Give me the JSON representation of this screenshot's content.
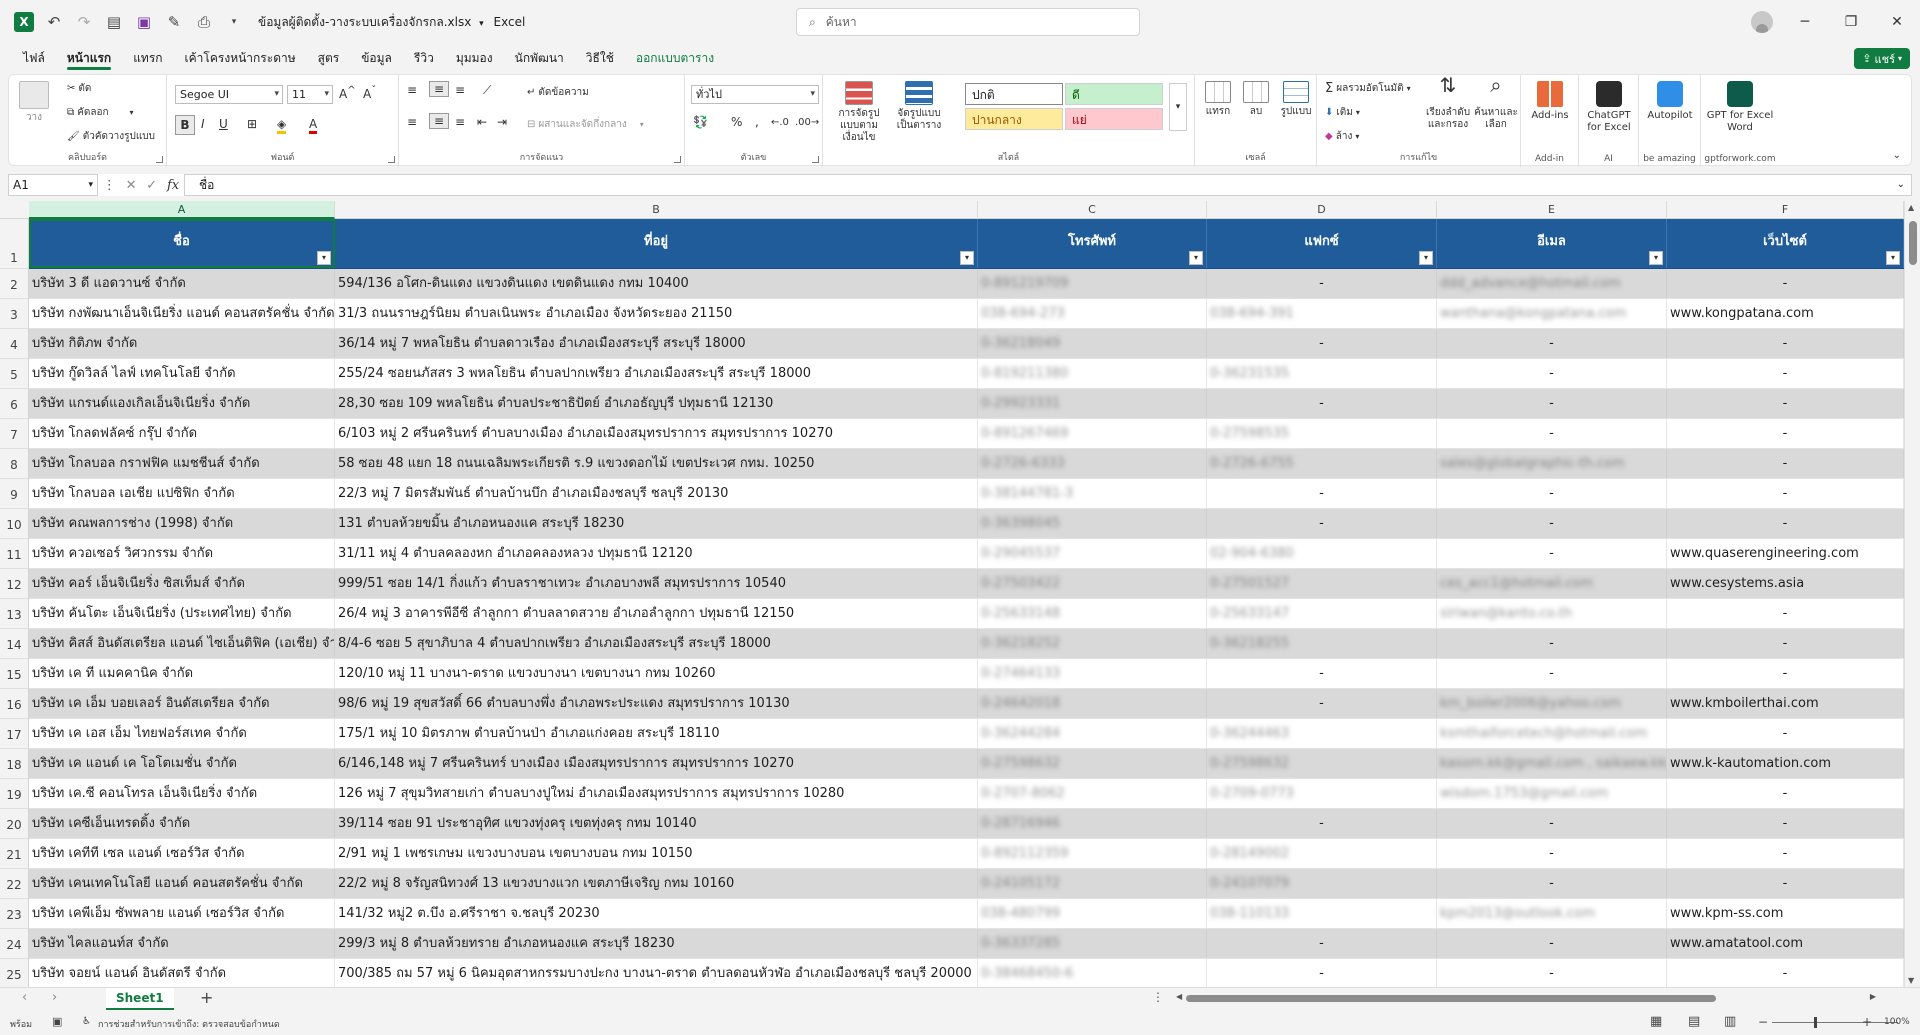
{
  "window": {
    "file_name": "ข้อมูลผู้ติดตั้ง-วางระบบเครื่องจักรกล.xlsx",
    "app_name": "Excel",
    "search_placeholder": "ค้นหา",
    "share_label": "แชร์"
  },
  "menu": [
    "ไฟล์",
    "หน้าแรก",
    "แทรก",
    "เค้าโครงหน้ากระดาษ",
    "สูตร",
    "ข้อมูล",
    "รีวิว",
    "มุมมอง",
    "นักพัฒนา",
    "วิธีใช้",
    "ออกแบบตาราง"
  ],
  "ribbon": {
    "clipboard": {
      "label": "คลิปบอร์ด",
      "paste": "วาง",
      "cut": "ตัด",
      "copy": "คัดลอก",
      "format_painter": "ตัวคัดวางรูปแบบ"
    },
    "font": {
      "label": "ฟอนต์",
      "name": "Segoe UI",
      "size": "11"
    },
    "alignment": {
      "label": "การจัดแนว",
      "wrap": "ตัดข้อความ",
      "merge": "ผสานและจัดกึ่งกลาง"
    },
    "number": {
      "label": "ตัวเลข",
      "format": "ทั่วไป"
    },
    "styles": {
      "label": "สไตล์",
      "cond": "การจัดรูปแบบตามเงื่อนไข",
      "table": "จัดรูปแบบเป็นตาราง",
      "normal": "ปกติ",
      "good": "ดี",
      "neutral": "ปานกลาง",
      "bad": "แย่"
    },
    "cells": {
      "label": "เซลล์",
      "insert": "แทรก",
      "delete": "ลบ",
      "format": "รูปแบบ"
    },
    "editing": {
      "label": "การแก้ไข",
      "autosum": "ผลรวมอัตโนมัติ",
      "fill": "เติม",
      "clear": "ล้าง",
      "sort": "เรียงลำดับและกรอง",
      "find": "ค้นหาและเลือก"
    },
    "addins": {
      "label": "Add-in",
      "btn": "Add-ins"
    },
    "ai": {
      "label": "AI",
      "btn": "ChatGPT for Excel"
    },
    "autopilot": {
      "label": "be amazing",
      "btn": "Autopilot"
    },
    "gptword": {
      "label": "gptforwork.com",
      "btn": "GPT for Excel Word"
    }
  },
  "formula": {
    "cell": "A1",
    "content": "ชื่อ"
  },
  "columns": [
    "A",
    "B",
    "C",
    "D",
    "E",
    "F"
  ],
  "headers": [
    "ชื่อ",
    "ที่อยู่",
    "โทรศัพท์",
    "แฟกซ์",
    "อีเมล",
    "เว็บไซต์"
  ],
  "rows": [
    {
      "n": "2",
      "name": "บริษัท 3 ดี แอดวานซ์ จำกัด",
      "addr": "594/136 อโศก-ดินแดง แขวงดินแดง เขตดินแดง กทม 10400",
      "tel": "0-891219709",
      "fax": "-",
      "email": "ddd_advance@hotmail.com",
      "web": "-"
    },
    {
      "n": "3",
      "name": "บริษัท กงพัฒนาเอ็นจิเนียริ่ง แอนด์ คอนสตรัคชั่น จำกัด",
      "addr": "31/3 ถนนราษฎร์นิยม ตำบลเนินพระ อำเภอเมือง จังหวัดระยอง 21150",
      "tel": "038-694-273",
      "fax": "038-694-391",
      "email": "wanthana@kongpatana.com",
      "web": "www.kongpatana.com"
    },
    {
      "n": "4",
      "name": "บริษัท กิติภพ จำกัด",
      "addr": "36/14 หมู่ 7 พหลโยธิน ตำบลดาวเรือง อำเภอเมืองสระบุรี สระบุรี 18000",
      "tel": "0-36218049",
      "fax": "-",
      "email": "-",
      "web": "-"
    },
    {
      "n": "5",
      "name": "บริษัท กู๊ดวิลล์ ไลฟ์ เทคโนโลยี จำกัด",
      "addr": "255/24 ซอยนภัสสร 3 พหลโยธิน ตำบลปากเพรียว อำเภอเมืองสระบุรี สระบุรี 18000",
      "tel": "0-819211380",
      "fax": "0-36231535",
      "email": "-",
      "web": "-"
    },
    {
      "n": "6",
      "name": "บริษัท แกรนด์แองเกิลเอ็นจิเนียริ่ง จำกัด",
      "addr": "28,30 ซอย 109 พหลโยธิน ตำบลประชาธิปัตย์ อำเภอธัญบุรี ปทุมธานี 12130",
      "tel": "0-29923331",
      "fax": "-",
      "email": "-",
      "web": "-"
    },
    {
      "n": "7",
      "name": "บริษัท โกลดฟลัคซ์ กรุ๊ป จำกัด",
      "addr": "6/103 หมู่ 2 ศรีนครินทร์ ตำบลบางเมือง อำเภอเมืองสมุทรปราการ สมุทรปราการ 10270",
      "tel": "0-891267469",
      "fax": "0-27598535",
      "email": "-",
      "web": "-"
    },
    {
      "n": "8",
      "name": "บริษัท โกลบอล กราฟฟิค แมชชีนส์ จำกัด",
      "addr": "58 ซอย 48 แยก 18 ถนนเฉลิมพระเกียรติ ร.9 แขวงดอกไม้ เขตประเวศ กทม. 10250",
      "tel": "0-2726-6333",
      "fax": "0-2726-6755",
      "email": "sales@globalgraphic-th.com",
      "web": "-"
    },
    {
      "n": "9",
      "name": "บริษัท โกลบอล เอเชีย แปซิฟิก จำกัด",
      "addr": "22/3 หมู่ 7 มิตรสัมพันธ์ ตำบลบ้านบึก อำเภอเมืองชลบุรี ชลบุรี 20130",
      "tel": "0-38144781-3",
      "fax": "-",
      "email": "-",
      "web": "-"
    },
    {
      "n": "10",
      "name": "บริษัท คณพลการช่าง (1998) จำกัด",
      "addr": "131 ตำบลห้วยขมิ้น อำเภอหนองแค สระบุรี 18230",
      "tel": "0-36398045",
      "fax": "-",
      "email": "-",
      "web": "-"
    },
    {
      "n": "11",
      "name": "บริษัท ควอเซอร์ วิศวกรรม จำกัด",
      "addr": "31/11 หมู่ 4 ตำบลคลองหก อำเภอคลองหลวง ปทุมธานี 12120",
      "tel": "0-29045537",
      "fax": "02-904-6380",
      "email": "-",
      "web": "www.quaserengineering.com"
    },
    {
      "n": "12",
      "name": "บริษัท คอร์ เอ็นจิเนียริ่ง ซิสเท็มส์ จำกัด",
      "addr": "999/51 ซอย 14/1 กิ่งแก้ว ตำบลราชาเทวะ อำเภอบางพลี สมุทรปราการ 10540",
      "tel": "0-27503422",
      "fax": "0-27501527",
      "email": "ces_acc1@hotmail.com",
      "web": "www.cesystems.asia"
    },
    {
      "n": "13",
      "name": "บริษัท คันโตะ เอ็นจิเนียริ่ง (ประเทศไทย) จำกัด",
      "addr": "26/4 หมู่ 3 อาคารพีอีซี ลำลูกกา ตำบลลาดสวาย อำเภอลำลูกกา ปทุมธานี 12150",
      "tel": "0-25633148",
      "fax": "0-25633147",
      "email": "siriwan@kanto.co.th",
      "web": "-"
    },
    {
      "n": "14",
      "name": "บริษัท คิสส์ อินดัสเตรียล แอนด์ ไซเอ็นติฟิค (เอเชีย) จำกัด",
      "addr": "8/4-6 ซอย 5 สุขาภิบาล 4 ตำบลปากเพรียว อำเภอเมืองสระบุรี สระบุรี 18000",
      "tel": "0-36218252",
      "fax": "0-36218255",
      "email": "-",
      "web": "-"
    },
    {
      "n": "15",
      "name": "บริษัท เค ที แมคคานิค จำกัด",
      "addr": "120/10 หมู่ 11 บางนา-ตราด แขวงบางนา เขตบางนา กทม 10260",
      "tel": "0-27464133",
      "fax": "-",
      "email": "-",
      "web": "-"
    },
    {
      "n": "16",
      "name": "บริษัท เค เอ็ม บอยเลอร์ อินดัสเตรียล จำกัด",
      "addr": "98/6 หมู่ 19 สุขสวัสดิ์ 66 ตำบลบางพึ่ง อำเภอพระประแดง สมุทรปราการ 10130",
      "tel": "0-24642018",
      "fax": "-",
      "email": "km_boiler2006@yahoo.com",
      "web": "www.kmboilerthai.com"
    },
    {
      "n": "17",
      "name": "บริษัท เค เอส เอ็ม ไทยฟอร์สเทค จำกัด",
      "addr": "175/1 หมู่ 10 มิตรภาพ ตำบลบ้านป่า อำเภอแก่งคอย สระบุรี 18110",
      "tel": "0-36244284",
      "fax": "0-36244463",
      "email": "ksmthaiforcetech@hotmail.com",
      "web": "-"
    },
    {
      "n": "18",
      "name": "บริษัท เค แอนด์ เค โอโตเมชั่น จำกัด",
      "addr": "6/146,148 หมู่ 7 ศรีนครินทร์ บางเมือง เมืองสมุทรปราการ สมุทรปราการ 10270",
      "tel": "0-27598632",
      "fax": "0-27598632",
      "email": "kasorn.kk@gmail.com , saikaew.kk@gmail.com",
      "web": "www.k-kautomation.com"
    },
    {
      "n": "19",
      "name": "บริษัท เค.ซี คอนโทรล เอ็นจิเนียริ่ง จำกัด",
      "addr": "126 หมู่ 7 สุขุมวิทสายเก่า ตำบลบางปูใหม่ อำเภอเมืองสมุทรปราการ สมุทรปราการ 10280",
      "tel": "0-2707-8062",
      "fax": "0-2709-0773",
      "email": "wisdom.1753@gmail.com",
      "web": "-"
    },
    {
      "n": "20",
      "name": "บริษัท เคซีเอ็นเทรดดิ้ง จำกัด",
      "addr": "39/114 ซอย 91 ประชาอุทิศ แขวงทุ่งครุ เขตทุ่งครุ กทม 10140",
      "tel": "0-28716946",
      "fax": "-",
      "email": "-",
      "web": "-"
    },
    {
      "n": "21",
      "name": "บริษัท เคทีที เซล แอนด์ เซอร์วิส จำกัด",
      "addr": "2/91 หมู่ 1 เพชรเกษม แขวงบางบอน เขตบางบอน กทม 10150",
      "tel": "0-892112359",
      "fax": "0-28149002",
      "email": "-",
      "web": "-"
    },
    {
      "n": "22",
      "name": "บริษัท เคนเทคโนโลยี แอนด์ คอนสตรัคชั่น จำกัด",
      "addr": "22/2 หมู่ 8 จรัญสนิทวงศ์ 13 แขวงบางแวก เขตภาษีเจริญ กทม 10160",
      "tel": "0-24105172",
      "fax": "0-24107079",
      "email": "-",
      "web": "-"
    },
    {
      "n": "23",
      "name": "บริษัท เคพีเอ็ม ซัพพลาย แอนด์ เซอร์วิส จำกัด",
      "addr": "141/32 หมู่2 ต.บึง อ.ศรีราชา จ.ชลบุรี 20230",
      "tel": "038-480799",
      "fax": "038-110133",
      "email": "kpm2013@outlook.com",
      "web": "www.kpm-ss.com"
    },
    {
      "n": "24",
      "name": "บริษัท ไคลแอนท์ส จำกัด",
      "addr": "299/3 หมู่ 8 ตำบลห้วยทราย อำเภอหนองแค สระบุรี 18230",
      "tel": "0-36337285",
      "fax": "-",
      "email": "-",
      "web": "www.amatatool.com"
    },
    {
      "n": "25",
      "name": "บริษัท จอยน์ แอนด์ อินดัสตรี จำกัด",
      "addr": "700/385 ถม 57 หมู่ 6 นิคมอุตสาหกรรมบางปะกง บางนา-ตราด ตำบลดอนหัวฬ่อ อำเภอเมืองชลบุรี ชลบุรี 20000",
      "tel": "0-38468450-6",
      "fax": "-",
      "email": "-",
      "web": "-"
    }
  ],
  "sheet": {
    "tab": "Sheet1"
  },
  "status": {
    "ready": "พร้อม",
    "accessibility": "การช่วยสำหรับการเข้าถึง: ตรวจสอบข้อกำหนด",
    "zoom": "100%"
  }
}
